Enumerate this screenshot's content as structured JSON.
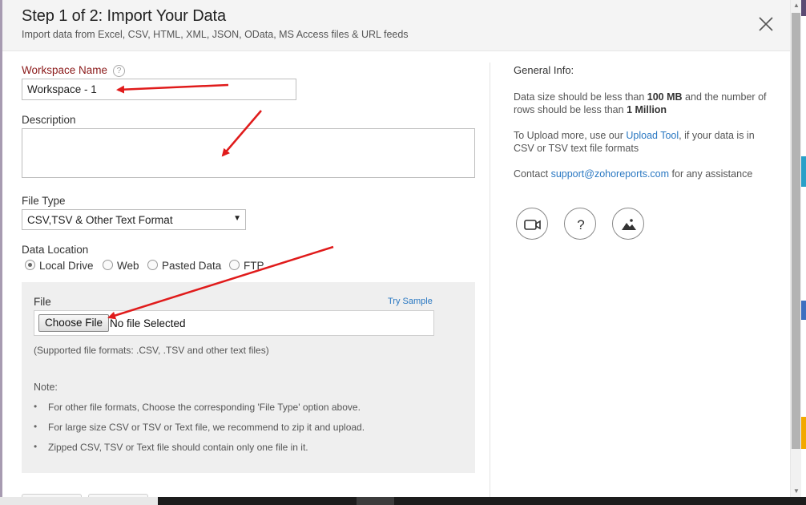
{
  "dialog": {
    "title": "Step 1 of 2: Import Your Data",
    "subtitle": "Import data from Excel, CSV, HTML, XML, JSON, OData, MS Access files & URL feeds",
    "close_icon": "close-icon"
  },
  "form": {
    "workspace_name_label": "Workspace Name",
    "workspace_name_help": "?",
    "workspace_name_value": "Workspace - 1",
    "description_label": "Description",
    "description_value": "",
    "file_type_label": "File Type",
    "file_type_selected": "CSV,TSV & Other Text Format",
    "data_location_label": "Data Location",
    "data_location_options": [
      {
        "label": "Local Drive",
        "selected": true
      },
      {
        "label": "Web",
        "selected": false
      },
      {
        "label": "Pasted Data",
        "selected": false
      },
      {
        "label": "FTP",
        "selected": false
      }
    ]
  },
  "file_panel": {
    "file_label": "File",
    "try_sample": "Try Sample",
    "choose_button": "Choose File",
    "no_file_text": "No file Selected",
    "supported_formats": "(Supported file formats: .CSV, .TSV and other text files)",
    "note_title": "Note:",
    "notes": [
      "For other file formats, Choose the corresponding 'File Type' option above.",
      "For large size CSV or TSV or Text file, we recommend to zip it and upload.",
      "Zipped CSV, TSV or Text file should contain only one file in it."
    ]
  },
  "general_info": {
    "title": "General Info:",
    "size_pre": "Data size should be less than ",
    "size_limit": "100 MB",
    "size_mid": " and the number of rows should be less than ",
    "rows_limit": "1 Million",
    "upload_pre": "To Upload more, use our ",
    "upload_link": "Upload Tool",
    "upload_post": ", if your data is in CSV or TSV text file formats",
    "contact_pre": "Contact ",
    "contact_email": "support@zohoreports.com",
    "contact_post": " for any assistance",
    "icons": [
      "video-icon",
      "help-icon",
      "image-icon"
    ]
  },
  "colors": {
    "required_label": "#8b1a1a",
    "link": "#2a78c2",
    "annotation_arrow": "#e01b1b",
    "panel_bg": "#efefef"
  }
}
